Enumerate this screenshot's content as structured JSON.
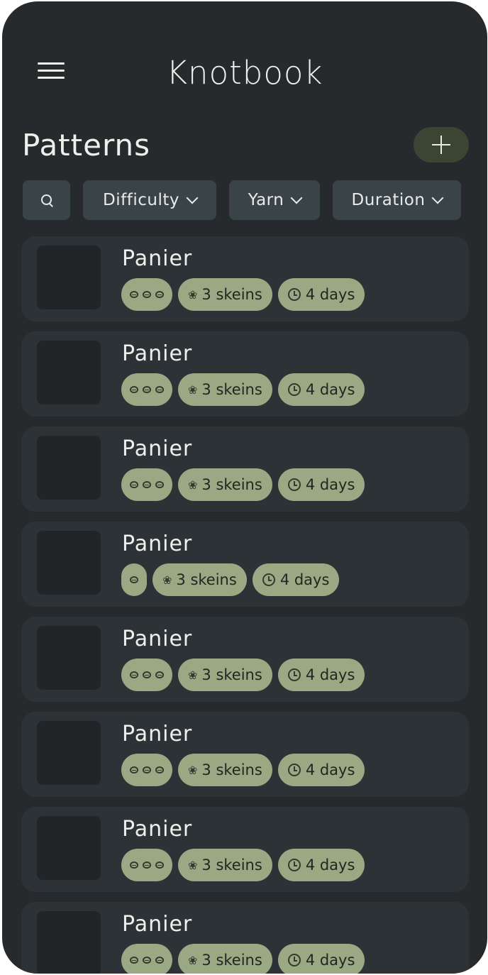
{
  "app": {
    "title": "Knotbook"
  },
  "page": {
    "title": "Patterns"
  },
  "filters": {
    "difficulty": "Difficulty",
    "yarn": "Yarn",
    "duration": "Duration"
  },
  "patterns": [
    {
      "title": "Panier",
      "difficulty": 3,
      "yarn": "3 skeins",
      "duration": "4 days"
    },
    {
      "title": "Panier",
      "difficulty": 3,
      "yarn": "3 skeins",
      "duration": "4 days"
    },
    {
      "title": "Panier",
      "difficulty": 3,
      "yarn": "3 skeins",
      "duration": "4 days"
    },
    {
      "title": "Panier",
      "difficulty": 1,
      "yarn": "3 skeins",
      "duration": "4 days"
    },
    {
      "title": "Panier",
      "difficulty": 3,
      "yarn": "3 skeins",
      "duration": "4 days"
    },
    {
      "title": "Panier",
      "difficulty": 3,
      "yarn": "3 skeins",
      "duration": "4 days"
    },
    {
      "title": "Panier",
      "difficulty": 3,
      "yarn": "3 skeins",
      "duration": "4 days"
    },
    {
      "title": "Panier",
      "difficulty": 3,
      "yarn": "3 skeins",
      "duration": "4 days"
    }
  ],
  "colors": {
    "background": "#262a2d",
    "card": "#2d3236",
    "chip": "#3a4347",
    "tag": "#9aa984",
    "add_button": "#3c4534"
  },
  "icons": {
    "menu": "menu-icon",
    "add": "plus-icon",
    "search": "search-icon",
    "difficulty": "knot-icon",
    "yarn": "yarn-icon",
    "duration": "clock-icon"
  }
}
